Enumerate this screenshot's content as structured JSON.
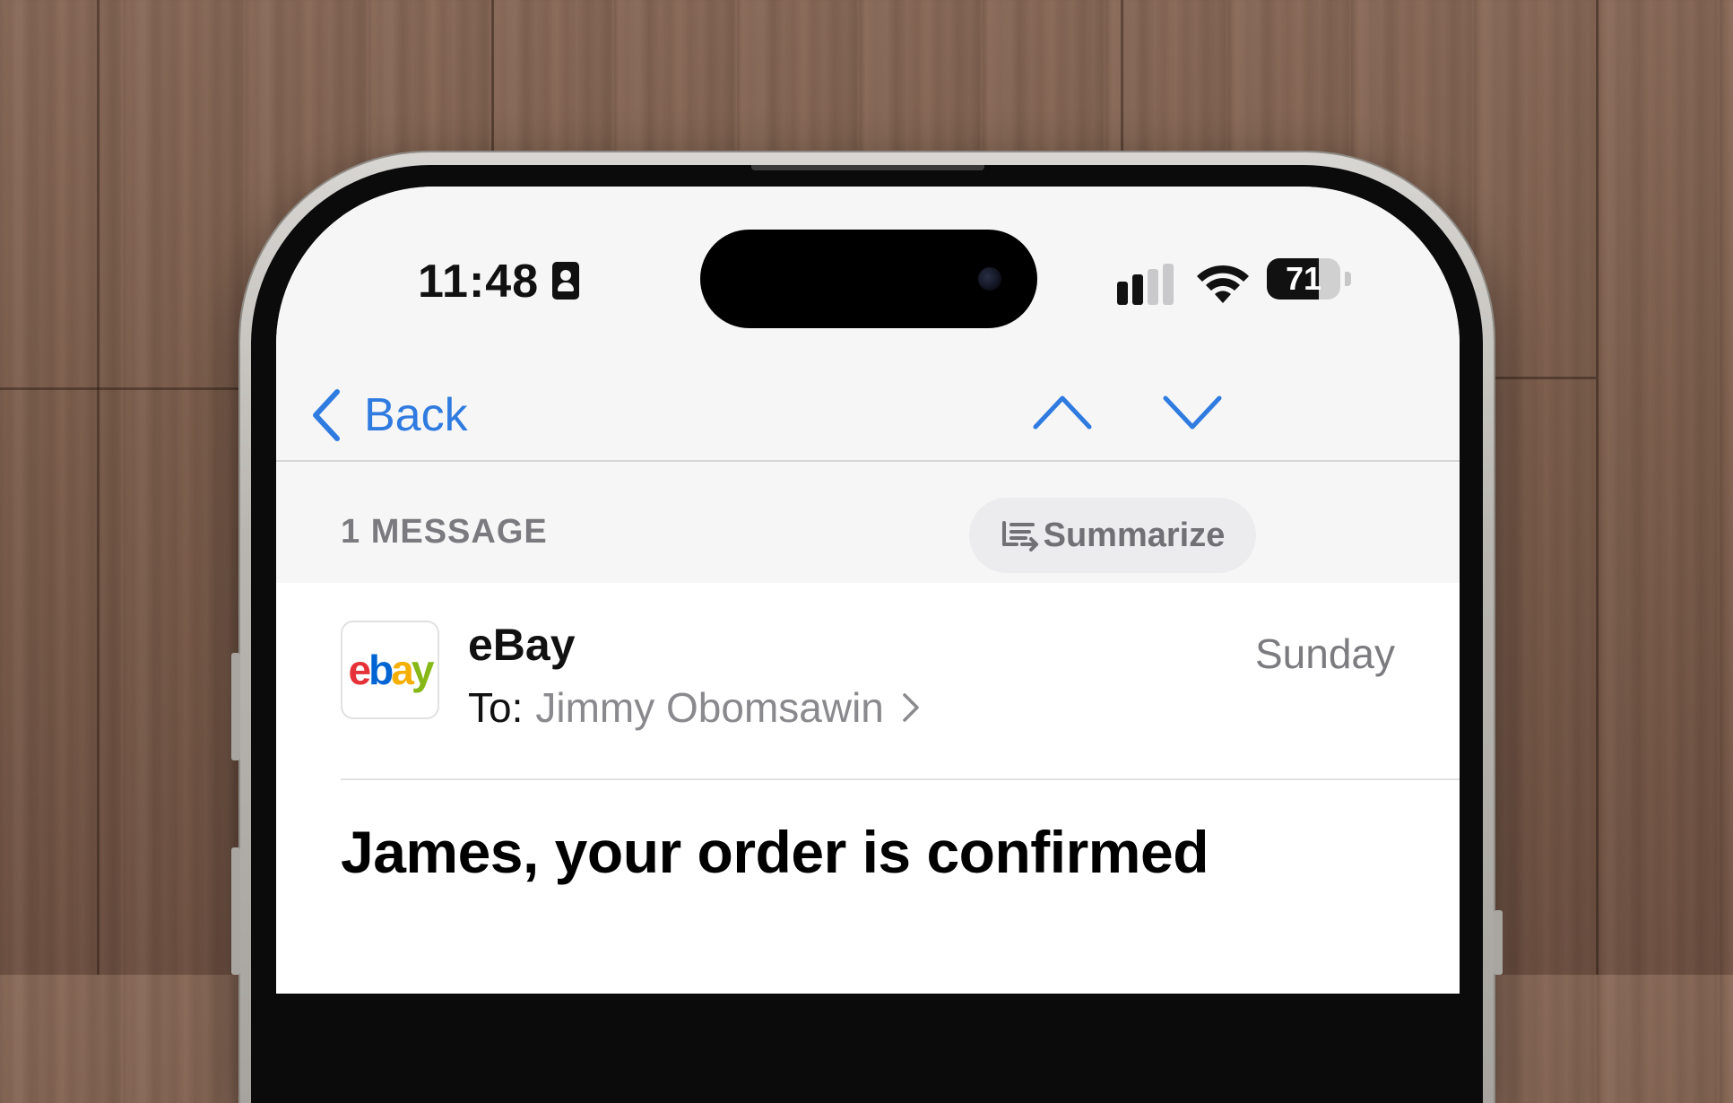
{
  "status_bar": {
    "time": "11:48",
    "battery_level": "71",
    "battery_fraction": 0.71,
    "signal_bars_active": 2,
    "signal_bars_total": 4
  },
  "nav": {
    "back_label": "Back",
    "back_icon": "chevron-left-icon",
    "prev_icon": "chevron-up-icon",
    "next_icon": "chevron-down-icon",
    "accent_color": "#2f7be0"
  },
  "thread": {
    "message_count_label": "1 MESSAGE",
    "summarize_label": "Summarize",
    "summarize_icon": "summarize-lines-icon"
  },
  "message": {
    "avatar_logo": {
      "letters": [
        "e",
        "b",
        "a",
        "y"
      ],
      "colors": [
        "#e53238",
        "#0064d2",
        "#f5af02",
        "#86b817"
      ]
    },
    "sender": "eBay",
    "to_prefix": "To:",
    "recipient": "Jimmy Obomsawin",
    "date": "Sunday",
    "subject": "James, your order is confirmed"
  }
}
